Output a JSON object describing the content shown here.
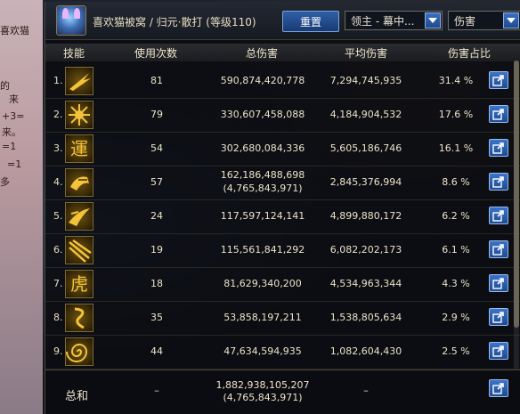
{
  "background": {
    "fragments": [
      "喜欢猫",
      "来",
      "来。",
      "=1",
      "+3=",
      "=1",
      "的",
      "多"
    ]
  },
  "header": {
    "player_name": "喜欢猫被窝 / 归元·散打 (等级110)",
    "reset_label": "重置",
    "target_select": "领主 - 幕中...",
    "metric_select": "伤害"
  },
  "columns": {
    "skill": "技能",
    "uses": "使用次数",
    "total": "总伤害",
    "avg": "平均伤害",
    "pct": "伤害占比"
  },
  "rows": [
    {
      "rank": "1.",
      "icon": "burst-icon",
      "uses": "81",
      "total": "590,874,420,778",
      "total_sub": "",
      "avg": "7,294,745,935",
      "pct": "31.4 %"
    },
    {
      "rank": "2.",
      "icon": "sunburst-icon",
      "uses": "79",
      "total": "330,607,458,088",
      "total_sub": "",
      "avg": "4,184,904,532",
      "pct": "17.6 %"
    },
    {
      "rank": "3.",
      "icon": "glyph-yun-icon",
      "uses": "54",
      "total": "302,680,084,336",
      "total_sub": "",
      "avg": "5,605,186,746",
      "pct": "16.1 %"
    },
    {
      "rank": "4.",
      "icon": "punch-icon",
      "uses": "57",
      "total": "162,186,488,698",
      "total_sub": "(4,765,843,971)",
      "avg": "2,845,376,994",
      "pct": "8.6 %"
    },
    {
      "rank": "5.",
      "icon": "dash-icon",
      "uses": "24",
      "total": "117,597,124,141",
      "total_sub": "",
      "avg": "4,899,880,172",
      "pct": "6.2 %"
    },
    {
      "rank": "6.",
      "icon": "slash-icon",
      "uses": "19",
      "total": "115,561,841,292",
      "total_sub": "",
      "avg": "6,082,202,173",
      "pct": "6.1 %"
    },
    {
      "rank": "7.",
      "icon": "glyph-hu-icon",
      "uses": "18",
      "total": "81,629,340,200",
      "total_sub": "",
      "avg": "4,534,963,344",
      "pct": "4.3 %"
    },
    {
      "rank": "8.",
      "icon": "swirl-icon",
      "uses": "35",
      "total": "53,858,197,211",
      "total_sub": "",
      "avg": "1,538,805,634",
      "pct": "2.9 %"
    },
    {
      "rank": "9.",
      "icon": "spiral-icon",
      "uses": "44",
      "total": "47,634,594,935",
      "total_sub": "",
      "avg": "1,082,604,430",
      "pct": "2.5 %"
    }
  ],
  "summary": {
    "label": "总和",
    "uses": "–",
    "total": "1,882,938,105,207",
    "total_sub": "(4,765,843,971)",
    "avg": "–"
  },
  "colors": {
    "accent_blue": "#2f5fa8",
    "text_gold": "#efe6cf",
    "icon_gold": "#f5c33a"
  }
}
